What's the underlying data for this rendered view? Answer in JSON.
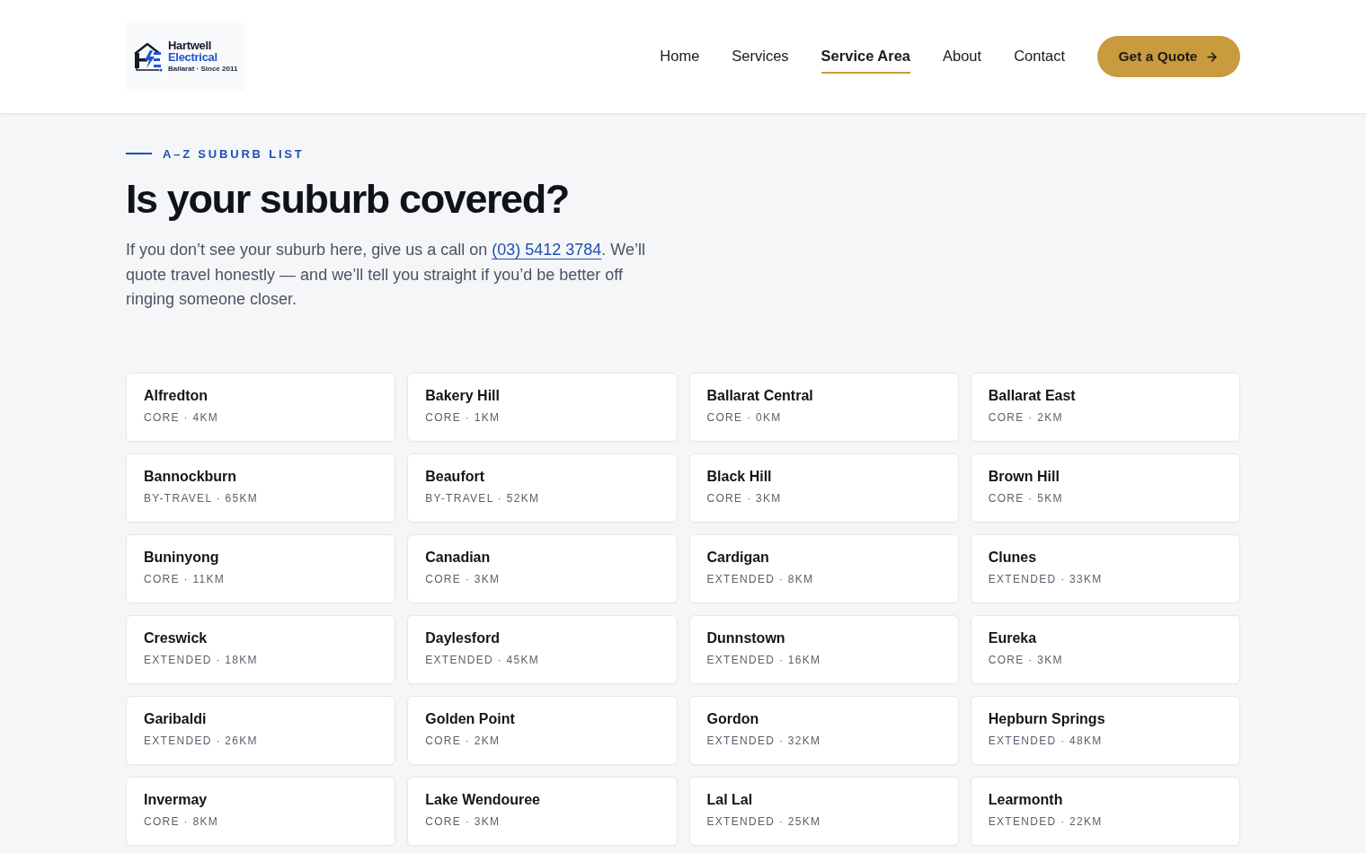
{
  "header": {
    "logo": {
      "name": "Hartwell",
      "subname": "Electrical",
      "tagline": "Ballarat · Since 2011"
    },
    "nav": {
      "items": [
        {
          "label": "Home",
          "selected": false
        },
        {
          "label": "Services",
          "selected": false
        },
        {
          "label": "Service Area",
          "selected": true
        },
        {
          "label": "About",
          "selected": false
        },
        {
          "label": "Contact",
          "selected": false
        }
      ]
    },
    "cta": {
      "label": "Get a Quote"
    }
  },
  "intro": {
    "eyebrow": "A–Z SUBURB LIST",
    "title": "Is your suburb covered?",
    "text_before": "If you don’t see your suburb here, give us a call on ",
    "phone_link": "(03) 5412 3784",
    "text_after": ". We’ll quote travel honestly — and we’ll tell you straight if you’d be better off ringing someone closer."
  },
  "suburbs": [
    {
      "name": "Alfredton",
      "meta": "CORE · 4KM"
    },
    {
      "name": "Bakery Hill",
      "meta": "CORE · 1KM"
    },
    {
      "name": "Ballarat Central",
      "meta": "CORE · 0KM"
    },
    {
      "name": "Ballarat East",
      "meta": "CORE · 2KM"
    },
    {
      "name": "Bannockburn",
      "meta": "BY-TRAVEL · 65KM"
    },
    {
      "name": "Beaufort",
      "meta": "BY-TRAVEL · 52KM"
    },
    {
      "name": "Black Hill",
      "meta": "CORE · 3KM"
    },
    {
      "name": "Brown Hill",
      "meta": "CORE · 5KM"
    },
    {
      "name": "Buninyong",
      "meta": "CORE · 11KM"
    },
    {
      "name": "Canadian",
      "meta": "CORE · 3KM"
    },
    {
      "name": "Cardigan",
      "meta": "EXTENDED · 8KM"
    },
    {
      "name": "Clunes",
      "meta": "EXTENDED · 33KM"
    },
    {
      "name": "Creswick",
      "meta": "EXTENDED · 18KM"
    },
    {
      "name": "Daylesford",
      "meta": "EXTENDED · 45KM"
    },
    {
      "name": "Dunnstown",
      "meta": "EXTENDED · 16KM"
    },
    {
      "name": "Eureka",
      "meta": "CORE · 3KM"
    },
    {
      "name": "Garibaldi",
      "meta": "EXTENDED · 26KM"
    },
    {
      "name": "Golden Point",
      "meta": "CORE · 2KM"
    },
    {
      "name": "Gordon",
      "meta": "EXTENDED · 32KM"
    },
    {
      "name": "Hepburn Springs",
      "meta": "EXTENDED · 48KM"
    },
    {
      "name": "Invermay",
      "meta": "CORE · 8KM"
    },
    {
      "name": "Lake Wendouree",
      "meta": "CORE · 3KM"
    },
    {
      "name": "Lal Lal",
      "meta": "EXTENDED · 25KM"
    },
    {
      "name": "Learmonth",
      "meta": "EXTENDED · 22KM"
    }
  ]
}
